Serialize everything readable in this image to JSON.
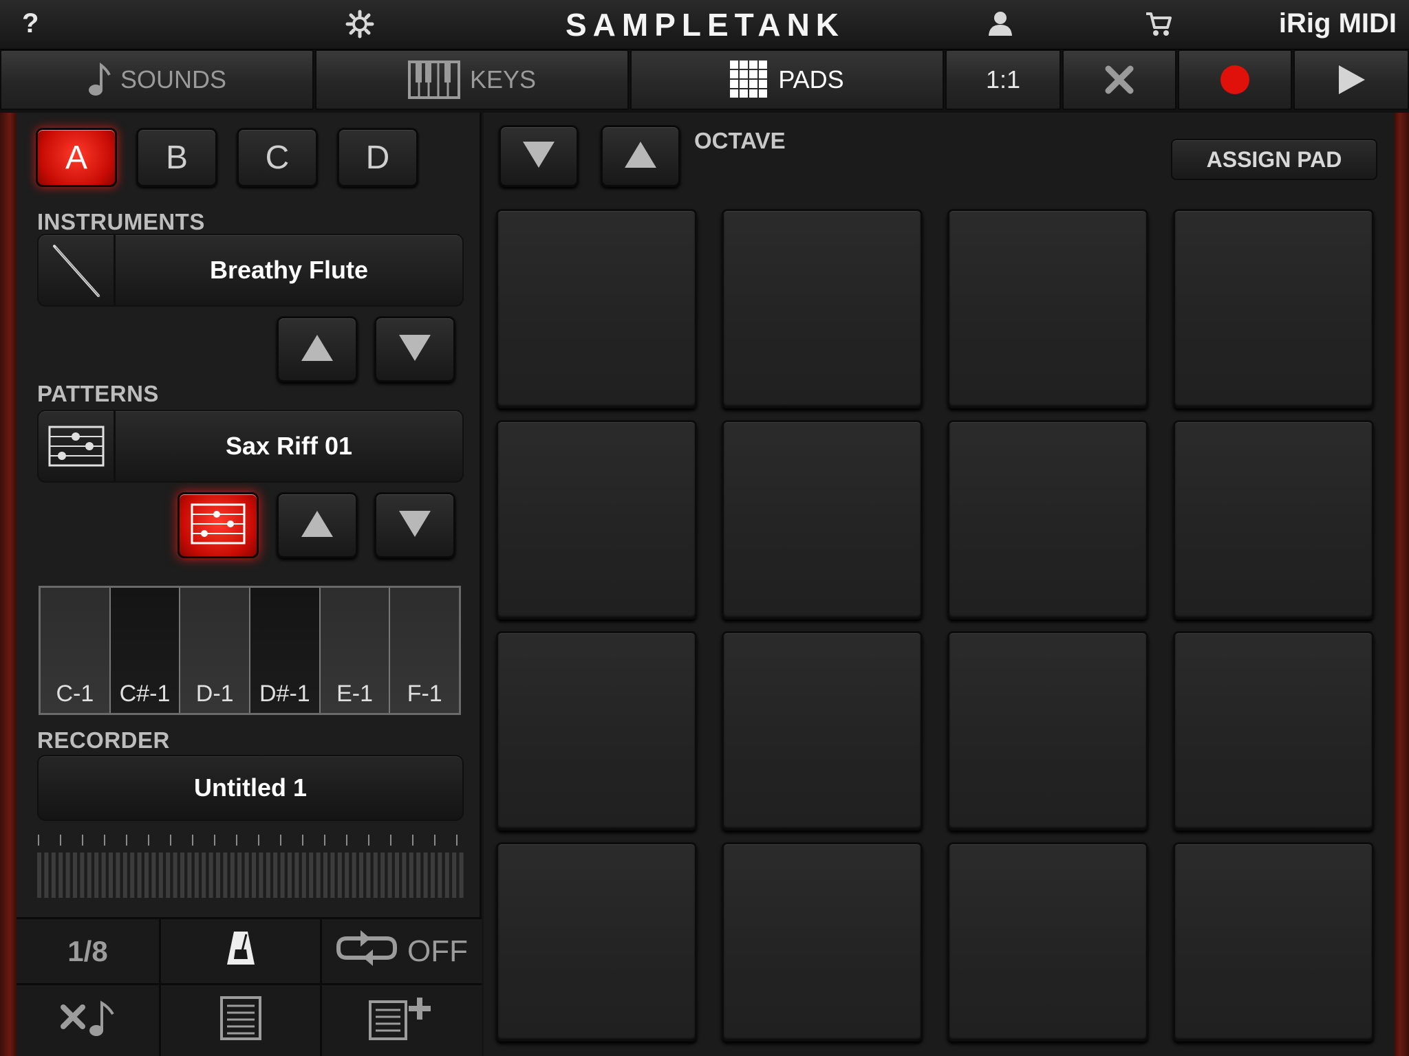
{
  "topbar": {
    "help": "?",
    "logo": "SAMPLETANK",
    "device": "iRig MIDI",
    "icons": [
      "gear-icon",
      "user-icon",
      "cart-icon"
    ]
  },
  "tabs": {
    "sounds": "SOUNDS",
    "keys": "KEYS",
    "pads": "PADS",
    "ratio": "1:1",
    "active": "pads",
    "record_color": "#e0100a"
  },
  "banks": [
    "A",
    "B",
    "C",
    "D"
  ],
  "active_bank": "A",
  "instruments": {
    "label": "INSTRUMENTS",
    "value": "Breathy Flute"
  },
  "patterns": {
    "label": "PATTERNS",
    "value": "Sax Riff 01"
  },
  "notes": [
    "C-1",
    "C#-1",
    "D-1",
    "D#-1",
    "E-1",
    "F-1"
  ],
  "recorder": {
    "label": "RECORDER",
    "value": "Untitled 1"
  },
  "bottom": {
    "quantize": "1/8",
    "loop": "OFF"
  },
  "pads": {
    "octave_label": "OCTAVE",
    "assign_label": "ASSIGN PAD",
    "rows": 4,
    "cols": 4
  },
  "colors": {
    "accent_red": "#d8120a",
    "rail": "#5e1810"
  }
}
